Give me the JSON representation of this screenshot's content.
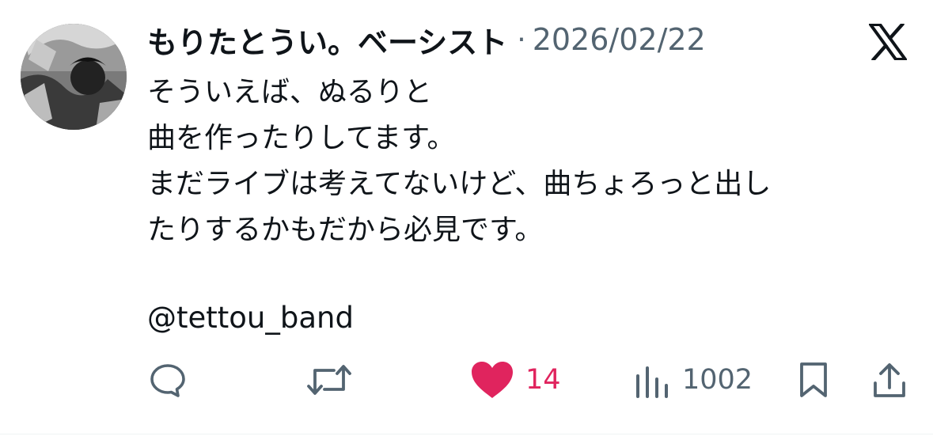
{
  "tweet": {
    "author": {
      "display_name": "もりたとうい。ベーシスト",
      "avatar_icon": "avatar-photo"
    },
    "separator": "·",
    "date": "2026/02/22",
    "platform_icon": "x-logo-icon",
    "text_lines": [
      "そういえば、ぬるりと",
      "曲を作ったりしてます。",
      "まだライブは考えてないけど、曲ちょろっと出し",
      "たりするかもだから必見です。"
    ],
    "mention": "@tettou_band"
  },
  "actions": {
    "reply": {
      "icon": "reply-bubble-icon"
    },
    "repost": {
      "icon": "repost-arrows-icon"
    },
    "like": {
      "icon": "heart-icon",
      "count": "14",
      "liked": true,
      "color": "#e0245e"
    },
    "views": {
      "icon": "bar-chart-icon",
      "count": "1002"
    },
    "bookmark": {
      "icon": "bookmark-icon"
    },
    "share": {
      "icon": "share-icon"
    }
  },
  "colors": {
    "text": "#0f1419",
    "secondary": "#536471",
    "like": "#e0245e"
  }
}
